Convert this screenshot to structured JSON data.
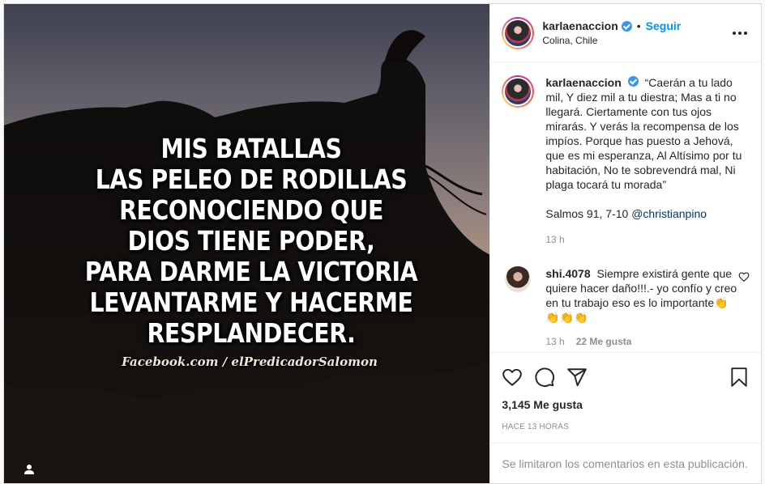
{
  "post": {
    "image": {
      "quote_lines": [
        "MIS BATALLAS",
        "LAS PELEO DE RODILLAS",
        "RECONOCIENDO QUE",
        "DIOS TIENE PODER,",
        "PARA DARME LA VICTORIA",
        "LEVANTARME Y HACERME",
        "RESPLANDECER."
      ],
      "watermark": "Facebook.com / elPredicadorSalomon",
      "tag_icon": "user-tag-icon"
    },
    "header": {
      "username": "karlaenaccion",
      "separator": "•",
      "follow_label": "Seguir",
      "location": "Colina, Chile",
      "more_icon": "more-options-icon"
    },
    "caption": {
      "username": "karlaenaccion",
      "text": "“Caerán a tu lado mil, Y diez mil a tu diestra; Mas a ti no llegará. Ciertamente con tus ojos mirarás. Y verás la recompensa de los impíos. Porque has puesto a Jehová, que es mi esperanza, Al Altísimo por tu habitación, No te sobrevendrá mal, Ni plaga tocará tu morada”",
      "reference": "Salmos 91, 7-10 ",
      "mention": "@christianpino",
      "time": "13 h"
    },
    "comments": [
      {
        "username": "shi.4078",
        "text": "Siempre existirá gente que quiere hacer daño!!!.- yo confío y creo en tu trabajo eso es lo importante👏👏👏👏",
        "time": "13 h",
        "likes": "22 Me gusta"
      }
    ],
    "actions": {
      "icons": [
        "heart-icon",
        "comment-icon",
        "share-icon",
        "bookmark-icon"
      ],
      "likes": "3,145 Me gusta",
      "timestamp": "HACE 13 HORAS",
      "comments_limited": "Se limitaron los comentarios en esta publicación."
    },
    "colors": {
      "accent": "#0095f6",
      "verified": "#3897f0",
      "muted": "#8e8e8e"
    }
  }
}
